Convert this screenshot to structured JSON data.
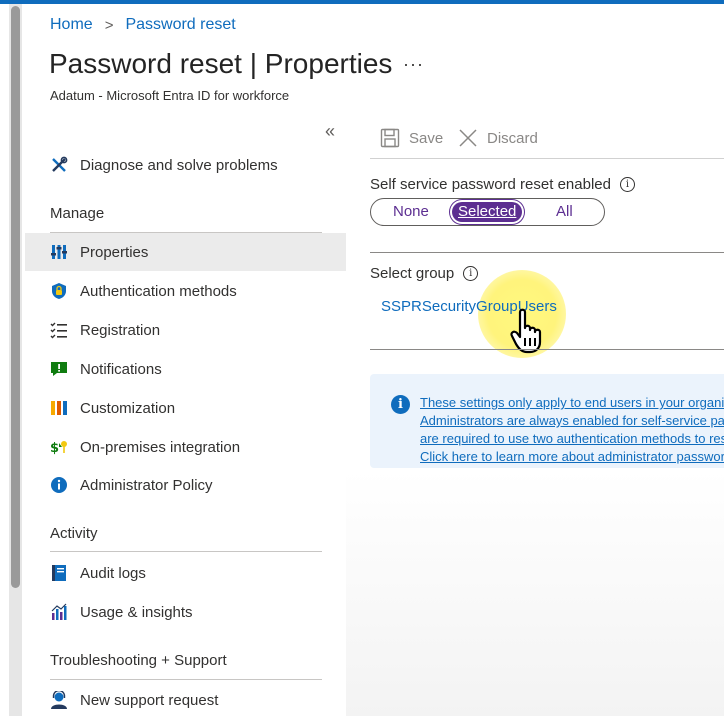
{
  "colors": {
    "accent": "#0f6cbd",
    "toggle_purple": "#5c2e91",
    "info_bg": "#ebf3fc"
  },
  "breadcrumb": {
    "home": "Home",
    "separator": ">",
    "current": "Password reset"
  },
  "page": {
    "title": "Password reset | Properties",
    "more": "···",
    "subtitle": "Adatum - Microsoft Entra ID for workforce"
  },
  "sidebar": {
    "collapse": "«",
    "diagnose": {
      "label": "Diagnose and solve problems",
      "icon": "tools-icon"
    },
    "sections": {
      "manage": "Manage",
      "activity": "Activity",
      "troubleshooting": "Troubleshooting + Support"
    },
    "manage_items": [
      {
        "label": "Properties",
        "icon": "properties-icon",
        "active": true
      },
      {
        "label": "Authentication methods",
        "icon": "shield-icon"
      },
      {
        "label": "Registration",
        "icon": "checklist-icon"
      },
      {
        "label": "Notifications",
        "icon": "notification-icon"
      },
      {
        "label": "Customization",
        "icon": "customization-icon"
      },
      {
        "label": "On-premises integration",
        "icon": "on-premises-icon"
      },
      {
        "label": "Administrator Policy",
        "icon": "info-icon"
      }
    ],
    "activity_items": [
      {
        "label": "Audit logs",
        "icon": "audit-log-icon"
      },
      {
        "label": "Usage & insights",
        "icon": "insights-icon"
      }
    ],
    "support_items": [
      {
        "label": "New support request",
        "icon": "support-person-icon"
      }
    ]
  },
  "toolbar": {
    "save_label": "Save",
    "discard_label": "Discard"
  },
  "sspr": {
    "label": "Self service password reset enabled",
    "info": "i",
    "options": [
      "None",
      "Selected",
      "All"
    ],
    "selected": "Selected"
  },
  "group": {
    "label": "Select group",
    "info": "i",
    "value": "SSPRSecurityGroupUsers"
  },
  "notice": {
    "icon": "i",
    "text": "These settings only apply to end users in your organization. Administrators are always enabled for self-service password reset and are required to use two authentication methods to reset their password. Click here to learn more about administrator password policies."
  }
}
